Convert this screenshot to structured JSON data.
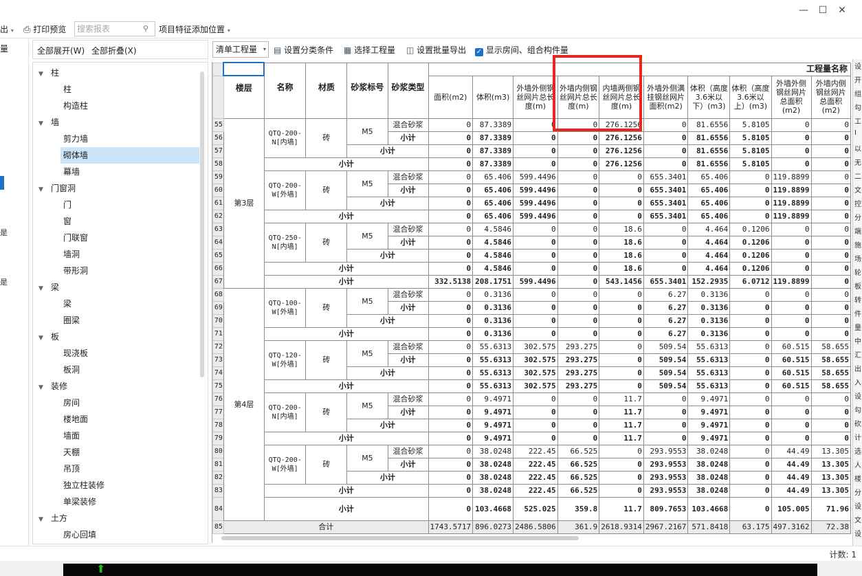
{
  "toolbar1": {
    "export_fragment": "出",
    "print_preview": "打印预览",
    "search_placeholder": "搜索报表",
    "project_feature": "项目特征添加位置"
  },
  "leftstrip": {
    "label": "量",
    "markers": [
      "是",
      "是"
    ]
  },
  "tree_header": {
    "expand_all": "全部展开(W)",
    "collapse_all": "全部折叠(X)"
  },
  "tree": [
    {
      "label": "柱",
      "level": 0
    },
    {
      "label": "柱",
      "level": 1
    },
    {
      "label": "构造柱",
      "level": 1
    },
    {
      "label": "墙",
      "level": 0
    },
    {
      "label": "剪力墙",
      "level": 1
    },
    {
      "label": "砌体墙",
      "level": 1,
      "selected": true
    },
    {
      "label": "幕墙",
      "level": 1
    },
    {
      "label": "门窗洞",
      "level": 0
    },
    {
      "label": "门",
      "level": 1
    },
    {
      "label": "窗",
      "level": 1
    },
    {
      "label": "门联窗",
      "level": 1
    },
    {
      "label": "墙洞",
      "level": 1
    },
    {
      "label": "带形洞",
      "level": 1
    },
    {
      "label": "梁",
      "level": 0
    },
    {
      "label": "梁",
      "level": 1
    },
    {
      "label": "圈梁",
      "level": 1
    },
    {
      "label": "板",
      "level": 0
    },
    {
      "label": "现浇板",
      "level": 1
    },
    {
      "label": "板洞",
      "level": 1
    },
    {
      "label": "装修",
      "level": 0
    },
    {
      "label": "房间",
      "level": 1
    },
    {
      "label": "楼地面",
      "level": 1
    },
    {
      "label": "墙面",
      "level": 1
    },
    {
      "label": "天棚",
      "level": 1
    },
    {
      "label": "吊顶",
      "level": 1
    },
    {
      "label": "独立柱装修",
      "level": 1
    },
    {
      "label": "单梁装修",
      "level": 1
    },
    {
      "label": "土方",
      "level": 0
    },
    {
      "label": "房心回填",
      "level": 1
    }
  ],
  "toolbar2": {
    "list_type": "清单工程量",
    "classify": "设置分类条件",
    "select_qty": "选择工程量",
    "batch_export": "设置批量导出",
    "show_room": "显示房间、组合构件量"
  },
  "grid": {
    "group_header": "工程量名称",
    "headers": [
      "楼层",
      "名称",
      "材质",
      "砂浆标号",
      "砂浆类型",
      "面积(m2)",
      "体积(m3)",
      "外墙外侧钢丝网片总长度(m)",
      "外墙内侧钢丝网片总长度(m)",
      "内墙两侧钢丝网片总长度(m)",
      "外墙外侧满挂钢丝网片面积(m2)",
      "体积（高度3.6米以下）(m3)",
      "体积（高度3.6米以上）(m3)",
      "外墙外侧钢丝网片总面积(m2)",
      "外墙内侧钢丝网片总面积(m2)"
    ],
    "floors": [
      "第3层",
      "第4层"
    ],
    "material": "砖",
    "mortar_grade": "M5",
    "mortar_type": "混合砂浆",
    "subtotal": "小计",
    "total": "合计",
    "row_numbers": [
      55,
      56,
      57,
      58,
      59,
      60,
      61,
      62,
      63,
      64,
      65,
      66,
      67,
      68,
      69,
      70,
      71,
      72,
      73,
      74,
      75,
      76,
      77,
      78,
      79,
      80,
      81,
      82,
      83,
      84,
      85
    ],
    "components": [
      {
        "name": "QTQ-200-N[内墙]",
        "rows": [
          [
            "0",
            "87.3389",
            "0",
            "0",
            "276.1256",
            "0",
            "81.6556",
            "5.8105",
            "0",
            "0"
          ],
          [
            "0",
            "87.3389",
            "0",
            "0",
            "276.1256",
            "0",
            "81.6556",
            "5.8105",
            "0",
            "0"
          ],
          [
            "0",
            "87.3389",
            "0",
            "0",
            "276.1256",
            "0",
            "81.6556",
            "5.8105",
            "0",
            "0"
          ],
          [
            "0",
            "87.3389",
            "0",
            "0",
            "276.1256",
            "0",
            "81.6556",
            "5.8105",
            "0",
            "0"
          ]
        ]
      },
      {
        "name": "QTQ-200-W[外墙]",
        "rows": [
          [
            "0",
            "65.406",
            "599.4496",
            "0",
            "0",
            "655.3401",
            "65.406",
            "0",
            "119.8899",
            "0"
          ],
          [
            "0",
            "65.406",
            "599.4496",
            "0",
            "0",
            "655.3401",
            "65.406",
            "0",
            "119.8899",
            "0"
          ],
          [
            "0",
            "65.406",
            "599.4496",
            "0",
            "0",
            "655.3401",
            "65.406",
            "0",
            "119.8899",
            "0"
          ],
          [
            "0",
            "65.406",
            "599.4496",
            "0",
            "0",
            "655.3401",
            "65.406",
            "0",
            "119.8899",
            "0"
          ]
        ]
      },
      {
        "name": "QTQ-250-N[内墙]",
        "rows": [
          [
            "0",
            "4.5846",
            "0",
            "0",
            "18.6",
            "0",
            "4.464",
            "0.1206",
            "0",
            "0"
          ],
          [
            "0",
            "4.5846",
            "0",
            "0",
            "18.6",
            "0",
            "4.464",
            "0.1206",
            "0",
            "0"
          ],
          [
            "0",
            "4.5846",
            "0",
            "0",
            "18.6",
            "0",
            "4.464",
            "0.1206",
            "0",
            "0"
          ],
          [
            "0",
            "4.5846",
            "0",
            "0",
            "18.6",
            "0",
            "4.464",
            "0.1206",
            "0",
            "0"
          ]
        ]
      },
      {
        "name": "QTQ-100-W[外墙]",
        "rows": [
          [
            "0",
            "0.3136",
            "0",
            "0",
            "0",
            "6.27",
            "0.3136",
            "0",
            "0",
            "0"
          ],
          [
            "0",
            "0.3136",
            "0",
            "0",
            "0",
            "6.27",
            "0.3136",
            "0",
            "0",
            "0"
          ],
          [
            "0",
            "0.3136",
            "0",
            "0",
            "0",
            "6.27",
            "0.3136",
            "0",
            "0",
            "0"
          ],
          [
            "0",
            "0.3136",
            "0",
            "0",
            "0",
            "6.27",
            "0.3136",
            "0",
            "0",
            "0"
          ]
        ]
      },
      {
        "name": "QTQ-120-W[外墙]",
        "rows": [
          [
            "0",
            "55.6313",
            "302.575",
            "293.275",
            "0",
            "509.54",
            "55.6313",
            "0",
            "60.515",
            "58.655"
          ],
          [
            "0",
            "55.6313",
            "302.575",
            "293.275",
            "0",
            "509.54",
            "55.6313",
            "0",
            "60.515",
            "58.655"
          ],
          [
            "0",
            "55.6313",
            "302.575",
            "293.275",
            "0",
            "509.54",
            "55.6313",
            "0",
            "60.515",
            "58.655"
          ],
          [
            "0",
            "55.6313",
            "302.575",
            "293.275",
            "0",
            "509.54",
            "55.6313",
            "0",
            "60.515",
            "58.655"
          ]
        ]
      },
      {
        "name": "QTQ-200-N[内墙]",
        "rows": [
          [
            "0",
            "9.4971",
            "0",
            "0",
            "11.7",
            "0",
            "9.4971",
            "0",
            "0",
            "0"
          ],
          [
            "0",
            "9.4971",
            "0",
            "0",
            "11.7",
            "0",
            "9.4971",
            "0",
            "0",
            "0"
          ],
          [
            "0",
            "9.4971",
            "0",
            "0",
            "11.7",
            "0",
            "9.4971",
            "0",
            "0",
            "0"
          ],
          [
            "0",
            "9.4971",
            "0",
            "0",
            "11.7",
            "0",
            "9.4971",
            "0",
            "0",
            "0"
          ]
        ]
      },
      {
        "name": "QTQ-200-W[外墙]",
        "rows": [
          [
            "0",
            "38.0248",
            "222.45",
            "66.525",
            "0",
            "293.9553",
            "38.0248",
            "0",
            "44.49",
            "13.305"
          ],
          [
            "0",
            "38.0248",
            "222.45",
            "66.525",
            "0",
            "293.9553",
            "38.0248",
            "0",
            "44.49",
            "13.305"
          ],
          [
            "0",
            "38.0248",
            "222.45",
            "66.525",
            "0",
            "293.9553",
            "38.0248",
            "0",
            "44.49",
            "13.305"
          ],
          [
            "0",
            "38.0248",
            "222.45",
            "66.525",
            "0",
            "293.9553",
            "38.0248",
            "0",
            "44.49",
            "13.305"
          ]
        ]
      }
    ],
    "floor_subtotals": [
      [
        "332.5138",
        "208.1751",
        "599.4496",
        "0",
        "543.1456",
        "655.3401",
        "152.2935",
        "6.0712",
        "119.8899",
        "0"
      ],
      [
        "0",
        "103.4668",
        "525.025",
        "359.8",
        "11.7",
        "809.7653",
        "103.4668",
        "0",
        "105.005",
        "71.96"
      ]
    ],
    "grand_total": [
      "1743.5717",
      "896.0273",
      "2486.5806",
      "361.9",
      "2618.9314",
      "2967.2167",
      "571.8418",
      "63.175",
      "497.3162",
      "72.38"
    ]
  },
  "status": {
    "count": "计数: 1"
  },
  "rightstrip": [
    "设",
    "开",
    "组",
    "勾",
    "工",
    "Ⅰ",
    "以",
    "无",
    "二",
    "文",
    "控",
    "分",
    "端",
    "施",
    "场",
    "轮",
    "板",
    "转",
    "件",
    "量",
    "中",
    "汇",
    "出",
    "入",
    "设",
    "勾",
    "砍",
    "计",
    "选",
    "人",
    "楼",
    "分",
    "设",
    "文",
    "设"
  ],
  "colors": {
    "highlight": "#e8261f",
    "selected": "#cce4f7",
    "accent": "#1a73c9"
  }
}
